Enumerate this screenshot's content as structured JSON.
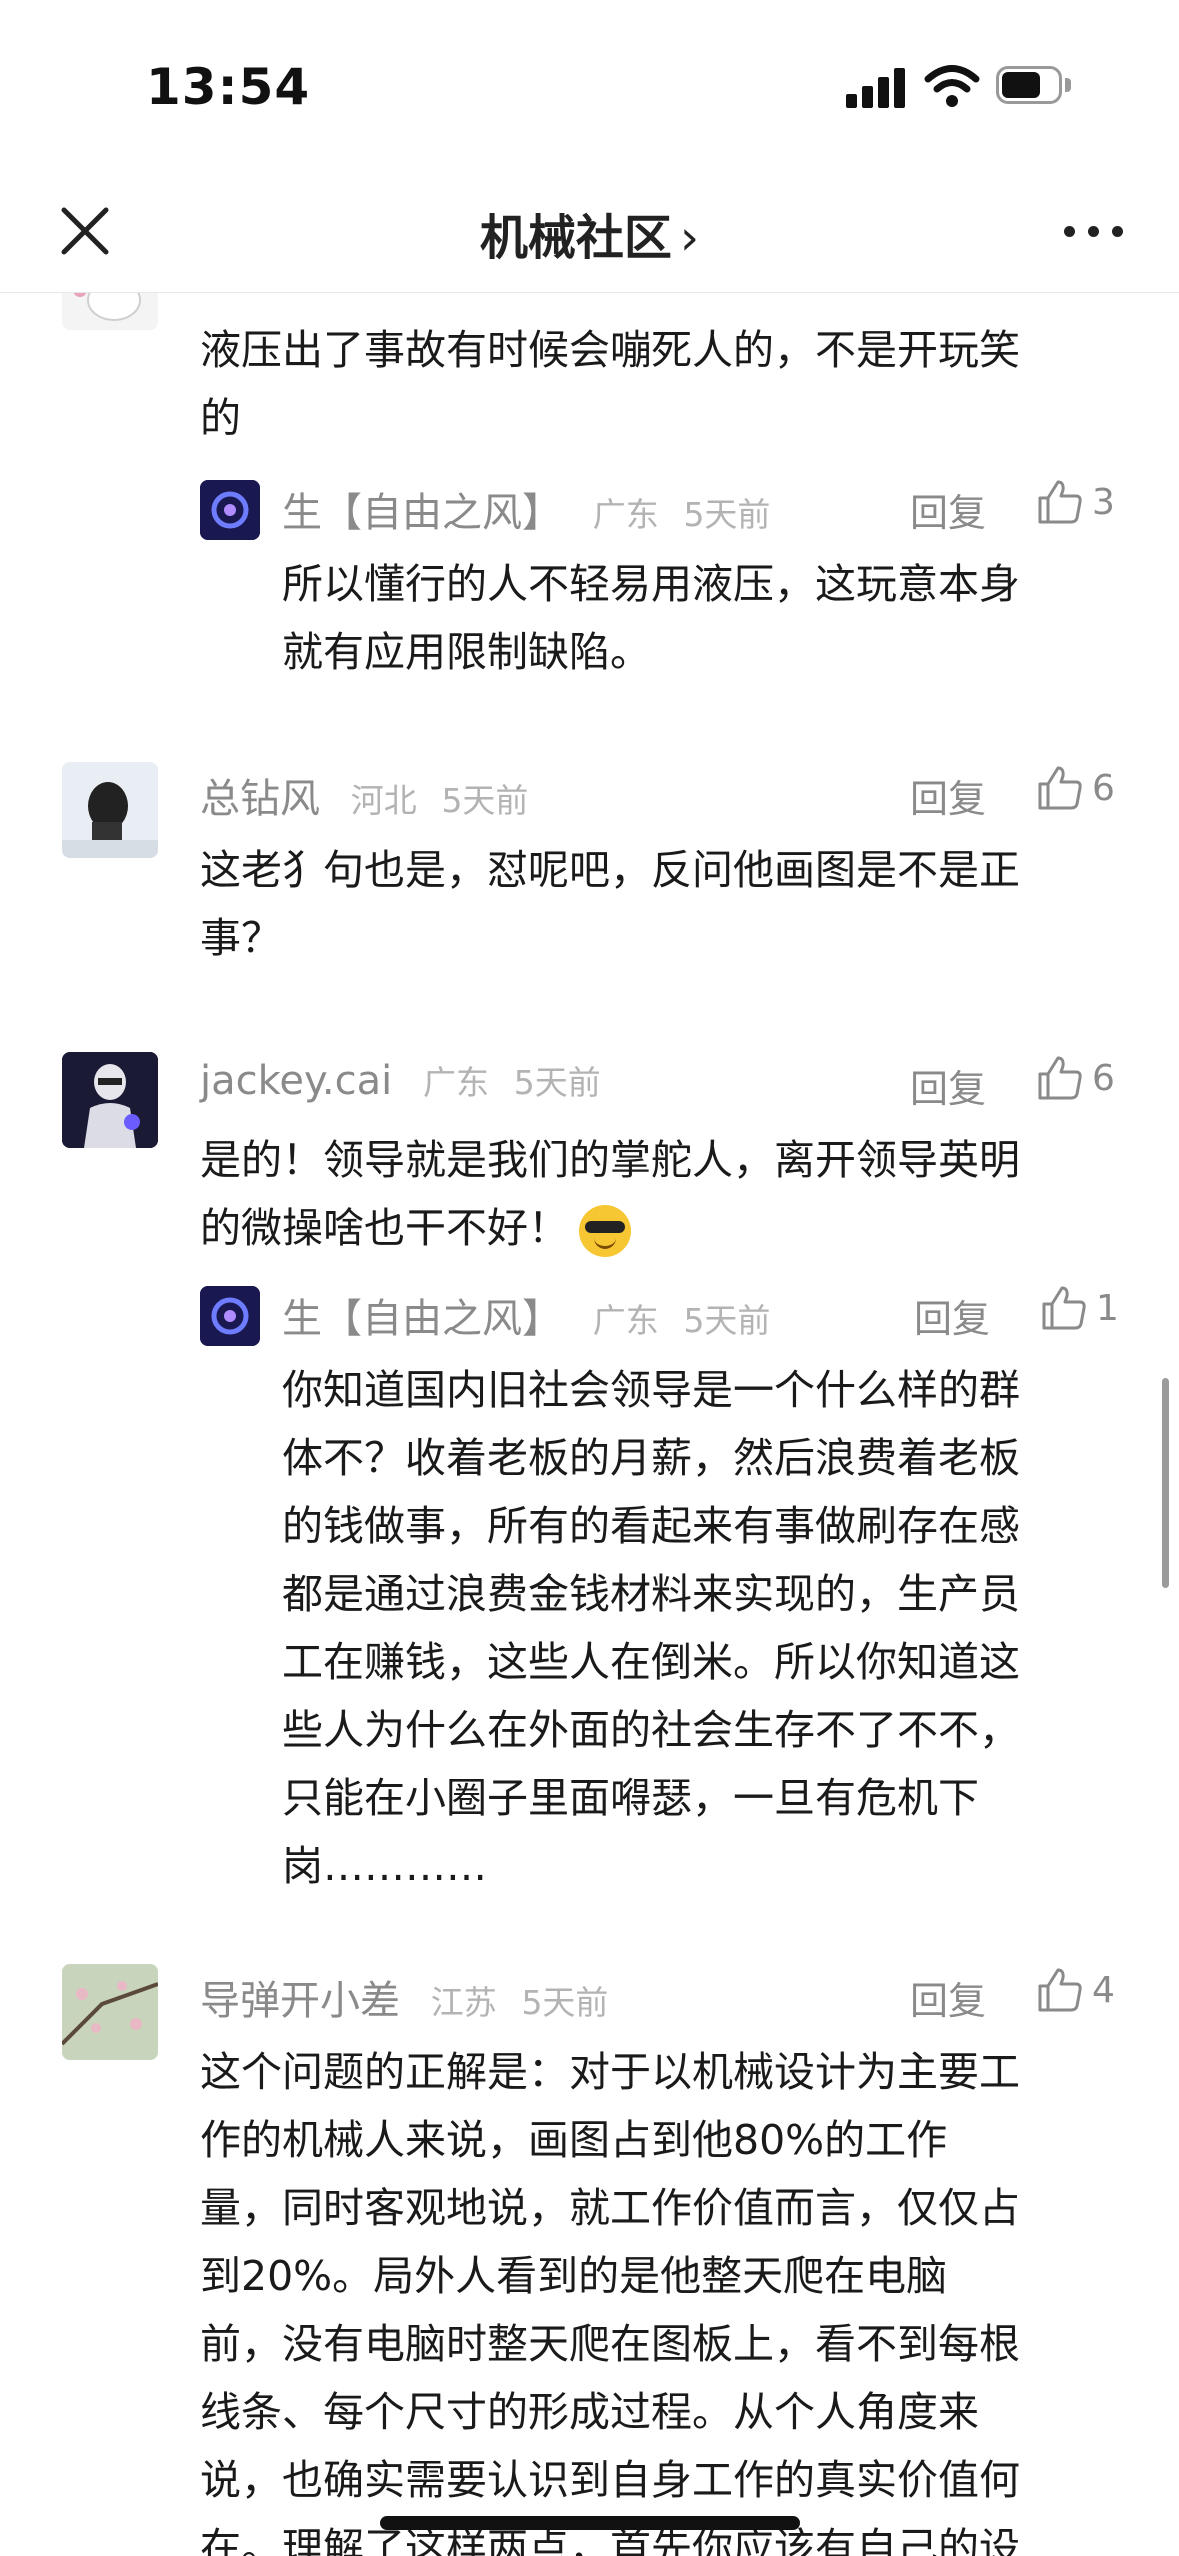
{
  "status_bar": {
    "time": "13:54"
  },
  "nav": {
    "title": "机械社区",
    "chevron": "›"
  },
  "comments": [
    {
      "text_lines": [
        "液压出了事故有时候会嘣死人的，不是开玩笑",
        "的"
      ],
      "reply": {
        "name": "生【自由之风】",
        "location": "广东",
        "time": "5天前",
        "reply_label": "回复",
        "likes": "3",
        "text_lines": [
          "所以懂行的人不轻易用液压，这玩意本身",
          "就有应用限制缺陷。"
        ]
      }
    },
    {
      "name": "总钻风",
      "location": "河北",
      "time": "5天前",
      "reply_label": "回复",
      "likes": "6",
      "text_lines": [
        "这老犭句也是，怼呢吧，反问他画图是不是正",
        "事？"
      ]
    },
    {
      "name": "jackey.cai",
      "location": "广东",
      "time": "5天前",
      "reply_label": "回复",
      "likes": "6",
      "text_lines": [
        "是的！领导就是我们的掌舵人，离开领导英明",
        "的微操啥也干不好！"
      ],
      "reply": {
        "name": "生【自由之风】",
        "location": "广东",
        "time": "5天前",
        "reply_label": "回复",
        "likes": "1",
        "text_lines": [
          "你知道国内旧社会领导是一个什么样的群",
          "体不？收着老板的月薪，然后浪费着老板",
          "的钱做事，所有的看起来有事做刷存在感",
          "都是通过浪费金钱材料来实现的，生产员",
          "工在赚钱，这些人在倒米。所以你知道这",
          "些人为什么在外面的社会生存不了不不，",
          "只能在小圈子里面嘚瑟，一旦有危机下",
          "岗…………"
        ]
      }
    },
    {
      "name": "导弹开小差",
      "location": "江苏",
      "time": "5天前",
      "reply_label": "回复",
      "likes": "4",
      "text_lines": [
        "这个问题的正解是：对于以机械设计为主要工",
        "作的机械人来说，画图占到他80%的工作",
        "量，同时客观地说，就工作价值而言，仅仅占",
        "到20%。局外人看到的是他整天爬在电脑",
        "前，没有电脑时整天爬在图板上，看不到每根",
        "线条、每个尺寸的形成过程。从个人角度来",
        "说，也确实需要认识到自身工作的真实价值何",
        "在。理解了这样两点，首先你应该有自己的设"
      ]
    }
  ],
  "colors": {
    "text": "#1a1a1a",
    "meta": "#8a8a8a",
    "location": "#b3b3b3"
  }
}
